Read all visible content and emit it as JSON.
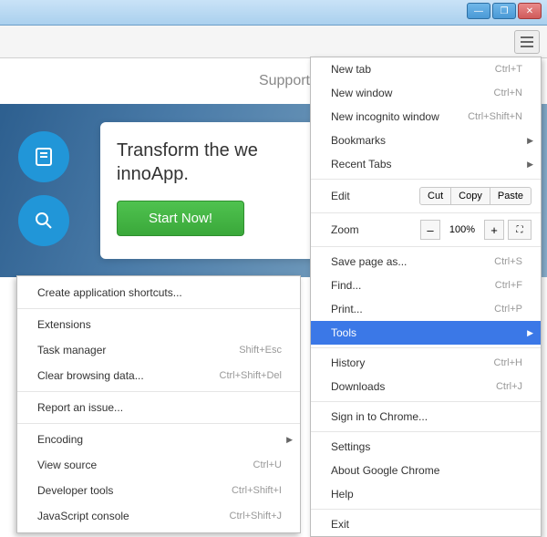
{
  "window": {
    "minimize": "—",
    "maximize": "❐",
    "close": "✕"
  },
  "page": {
    "support": "Support",
    "hero_line1": "Transform the we",
    "hero_line2": "innoApp.",
    "start": "Start Now!"
  },
  "menu": {
    "new_tab": {
      "label": "New tab",
      "shortcut": "Ctrl+T"
    },
    "new_window": {
      "label": "New window",
      "shortcut": "Ctrl+N"
    },
    "new_incognito": {
      "label": "New incognito window",
      "shortcut": "Ctrl+Shift+N"
    },
    "bookmarks": {
      "label": "Bookmarks"
    },
    "recent_tabs": {
      "label": "Recent Tabs"
    },
    "edit": {
      "label": "Edit",
      "cut": "Cut",
      "copy": "Copy",
      "paste": "Paste"
    },
    "zoom": {
      "label": "Zoom",
      "minus": "–",
      "value": "100%",
      "plus": "+",
      "fullscreen": "⛶"
    },
    "save_as": {
      "label": "Save page as...",
      "shortcut": "Ctrl+S"
    },
    "find": {
      "label": "Find...",
      "shortcut": "Ctrl+F"
    },
    "print": {
      "label": "Print...",
      "shortcut": "Ctrl+P"
    },
    "tools": {
      "label": "Tools"
    },
    "history": {
      "label": "History",
      "shortcut": "Ctrl+H"
    },
    "downloads": {
      "label": "Downloads",
      "shortcut": "Ctrl+J"
    },
    "signin": {
      "label": "Sign in to Chrome..."
    },
    "settings": {
      "label": "Settings"
    },
    "about": {
      "label": "About Google Chrome"
    },
    "help": {
      "label": "Help"
    },
    "exit": {
      "label": "Exit"
    }
  },
  "tools_menu": {
    "create_shortcuts": {
      "label": "Create application shortcuts..."
    },
    "extensions": {
      "label": "Extensions"
    },
    "task_manager": {
      "label": "Task manager",
      "shortcut": "Shift+Esc"
    },
    "clear_data": {
      "label": "Clear browsing data...",
      "shortcut": "Ctrl+Shift+Del"
    },
    "report_issue": {
      "label": "Report an issue..."
    },
    "encoding": {
      "label": "Encoding"
    },
    "view_source": {
      "label": "View source",
      "shortcut": "Ctrl+U"
    },
    "dev_tools": {
      "label": "Developer tools",
      "shortcut": "Ctrl+Shift+I"
    },
    "js_console": {
      "label": "JavaScript console",
      "shortcut": "Ctrl+Shift+J"
    }
  }
}
